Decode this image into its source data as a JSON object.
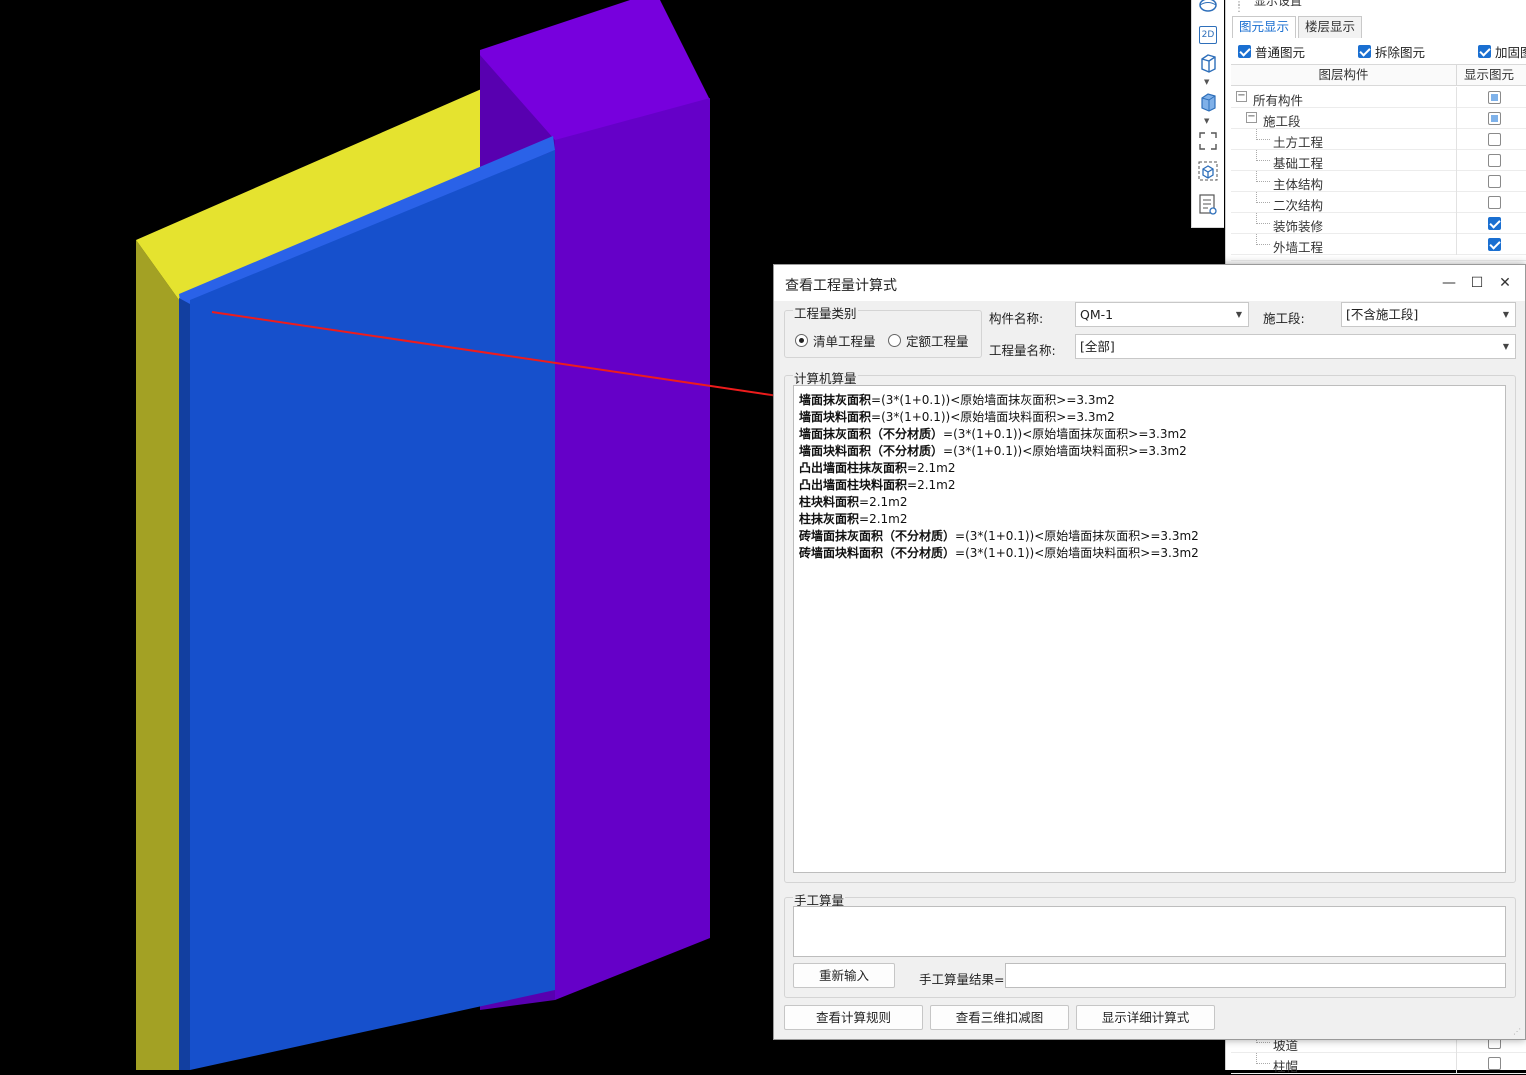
{
  "right_panel": {
    "title": "显示设置",
    "tabs": [
      "图元显示",
      "楼层显示"
    ],
    "checks": [
      {
        "label": "普通图元",
        "checked": true
      },
      {
        "label": "拆除图元",
        "checked": true
      },
      {
        "label": "加固图",
        "checked": true
      }
    ],
    "tree_header": {
      "col1": "图层构件",
      "col2": "显示图元"
    },
    "tree": [
      {
        "label": "所有构件",
        "state": "partial"
      },
      {
        "label": "施工段",
        "state": "partial"
      },
      {
        "label": "土方工程",
        "state": "off"
      },
      {
        "label": "基础工程",
        "state": "off"
      },
      {
        "label": "主体结构",
        "state": "off"
      },
      {
        "label": "二次结构",
        "state": "off"
      },
      {
        "label": "装饰装修",
        "state": "on"
      },
      {
        "label": "外墙工程",
        "state": "on"
      }
    ],
    "tree_bottom": [
      {
        "label": "坡道",
        "state": "off"
      },
      {
        "label": "柱帽",
        "state": "off"
      }
    ]
  },
  "toolbar_icons": [
    "sphere-icon",
    "2d-view-icon",
    "cube-outline-icon",
    "cube-solid-icon",
    "fullscreen-icon",
    "3d-box-icon",
    "list-settings-icon"
  ],
  "toolbar_2d_label": "2D",
  "dialog": {
    "title": "查看工程量计算式",
    "type_group": {
      "label": "工程量类别",
      "options": [
        {
          "label": "清单工程量",
          "selected": true
        },
        {
          "label": "定额工程量",
          "selected": false
        }
      ]
    },
    "component_label": "构件名称:",
    "component_value": "QM-1",
    "segment_label": "施工段:",
    "segment_value": "[不含施工段]",
    "quantity_label": "工程量名称:",
    "quantity_value": "[全部]",
    "computer_group_label": "计算机算量",
    "calc_lines": [
      {
        "name": "墙面抹灰面积",
        "expr": "=(3*(1+0.1))<原始墙面抹灰面积>=3.3m2"
      },
      {
        "name": "墙面块料面积",
        "expr": "=(3*(1+0.1))<原始墙面块料面积>=3.3m2"
      },
      {
        "name": "墙面抹灰面积（不分材质）",
        "expr": "=(3*(1+0.1))<原始墙面抹灰面积>=3.3m2"
      },
      {
        "name": "墙面块料面积（不分材质）",
        "expr": "=(3*(1+0.1))<原始墙面块料面积>=3.3m2"
      },
      {
        "name": "凸出墙面柱抹灰面积",
        "expr": "=2.1m2"
      },
      {
        "name": "凸出墙面柱块料面积",
        "expr": "=2.1m2"
      },
      {
        "name": "柱块料面积",
        "expr": "=2.1m2"
      },
      {
        "name": "柱抹灰面积",
        "expr": "=2.1m2"
      },
      {
        "name": "砖墙面抹灰面积（不分材质）",
        "expr": "=(3*(1+0.1))<原始墙面抹灰面积>=3.3m2"
      },
      {
        "name": "砖墙面块料面积（不分材质）",
        "expr": "=(3*(1+0.1))<原始墙面块料面积>=3.3m2"
      }
    ],
    "manual_group_label": "手工算量",
    "reset_button": "重新输入",
    "manual_result_label": "手工算量结果=",
    "manual_result_value": "",
    "buttons": [
      "查看计算规则",
      "查看三维扣减图",
      "显示详细计算式"
    ]
  },
  "colors": {
    "background": "#000000",
    "wall_blue": "#1650cc",
    "wall_yellow": "#e5e32f",
    "column_purple": "#6a00cc",
    "annotation_red": "#ee1c1c",
    "accent": "#1a6fd1"
  }
}
